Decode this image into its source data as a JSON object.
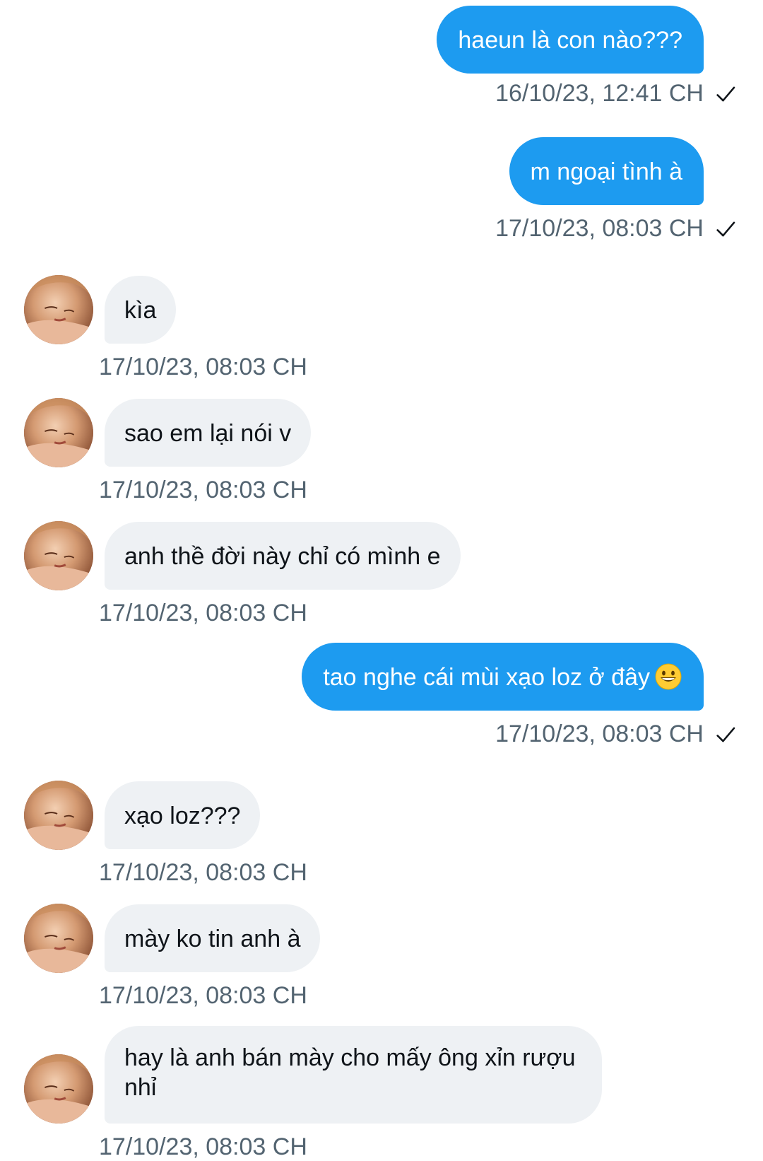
{
  "messages": [
    {
      "direction": "out",
      "text": "haeun là con nào???",
      "time": "16/10/23, 12:41 CH"
    },
    {
      "direction": "out",
      "text": "m ngoại tình à",
      "time": "17/10/23, 08:03 CH"
    },
    {
      "direction": "in",
      "text": "kìa",
      "time": "17/10/23, 08:03 CH"
    },
    {
      "direction": "in",
      "text": "sao em lại nói v",
      "time": "17/10/23, 08:03 CH"
    },
    {
      "direction": "in",
      "text": "anh thề đời này chỉ có mình e",
      "time": "17/10/23, 08:03 CH"
    },
    {
      "direction": "out",
      "text": "tao nghe cái mùi xạo loz ở đây",
      "emoji": "grinning-face-icon",
      "time": "17/10/23, 08:03 CH"
    },
    {
      "direction": "in",
      "text": "xạo loz???",
      "time": "17/10/23, 08:03 CH"
    },
    {
      "direction": "in",
      "text": "mày ko tin anh à",
      "time": "17/10/23, 08:03 CH"
    },
    {
      "direction": "in",
      "text": "hay là anh bán mày cho mấy ông xỉn rượu nhỉ",
      "time": "17/10/23, 08:03 CH"
    }
  ],
  "icons": {
    "read_receipt": "check-icon",
    "avatar": "avatar"
  },
  "colors": {
    "outgoing_bubble": "#1d9bf0",
    "incoming_bubble": "#eef1f4",
    "timestamp": "#536471",
    "incoming_text": "#0f1419"
  }
}
